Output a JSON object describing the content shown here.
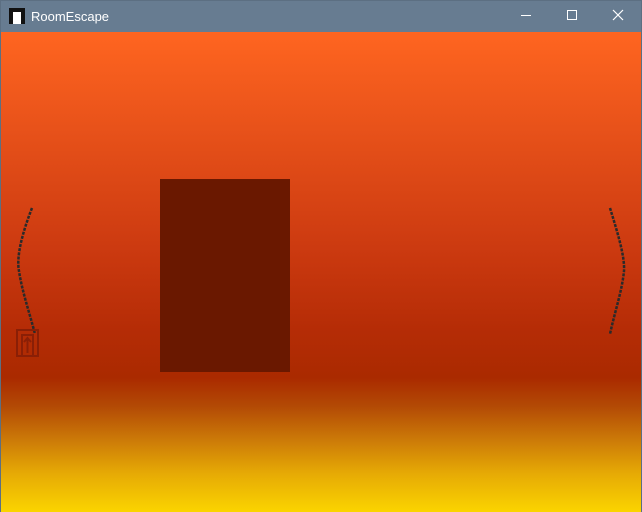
{
  "window": {
    "title": "RoomEscape",
    "app_icon": "door-icon",
    "controls": {
      "minimize_icon": "minimize-icon",
      "maximize_icon": "maximize-icon",
      "close_icon": "close-icon"
    }
  },
  "scene": {
    "wall_colors": [
      "#ff6520",
      "#aa2a00"
    ],
    "floor_colors": [
      "#aa2a00",
      "#fbd400"
    ],
    "door_color": "#6a1800",
    "left_nav_icon": "left-curve-arrow-icon",
    "right_nav_icon": "right-curve-arrow-icon",
    "exit_icon": "exit-door-icon"
  }
}
